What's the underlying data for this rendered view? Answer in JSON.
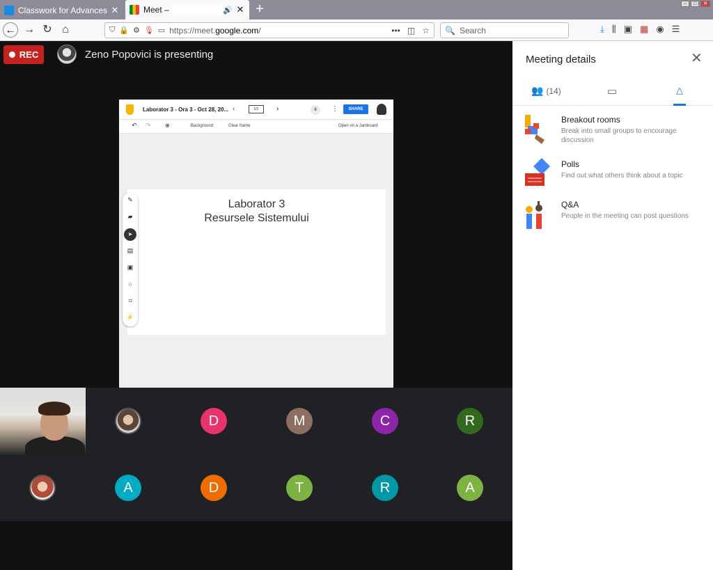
{
  "browser": {
    "tabs": [
      {
        "title": "Classwork for Advances in Con",
        "active": false
      },
      {
        "title": "Meet –",
        "active": true
      }
    ],
    "url_prefix": "https://meet.",
    "url_domain": "google.com",
    "url_suffix": "/",
    "search_placeholder": "Search",
    "new_tab": "+"
  },
  "meeting": {
    "rec_label": "REC",
    "presenter_text": "Zeno Popovici is presenting"
  },
  "jamboard": {
    "title": "Laborator 3 - Ora 3 - Oct 28, 20...",
    "frame": "1/1",
    "viewer_count": "8",
    "share_label": "SHARE",
    "background_label": "Background",
    "clear_label": "Clear frame",
    "open_label": "Open on a Jamboard",
    "canvas_line1": "Laborator 3",
    "canvas_line2": "Resursele Sistemului"
  },
  "participants": {
    "row1": [
      "",
      "D",
      "M",
      "C",
      "R"
    ],
    "row2": [
      "",
      "A",
      "D",
      "T",
      "R",
      "A"
    ],
    "colors": {
      "D1": "#e8336d",
      "M": "#8d6e63",
      "C": "#8e24aa",
      "R1": "#33691e",
      "A1": "#00acc1",
      "D2": "#ef6c00",
      "T": "#7cb342",
      "R2": "#0097a7",
      "A2": "#7cb342"
    }
  },
  "panel": {
    "title": "Meeting details",
    "people_count": "(14)",
    "activities": [
      {
        "name": "Breakout rooms",
        "desc": "Break into small groups to encourage discussion"
      },
      {
        "name": "Polls",
        "desc": "Find out what others think about a topic"
      },
      {
        "name": "Q&A",
        "desc": "People in the meeting can post questions"
      }
    ]
  }
}
